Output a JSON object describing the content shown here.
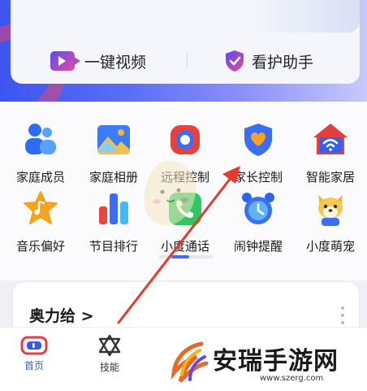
{
  "top_actions": [
    {
      "label": "一键视频",
      "icon": "video-call-icon"
    },
    {
      "label": "看护助手",
      "icon": "shield-icon"
    }
  ],
  "features": [
    {
      "label": "家庭成员",
      "icon": "family-members-icon"
    },
    {
      "label": "家庭相册",
      "icon": "photo-album-icon"
    },
    {
      "label": "远程控制",
      "icon": "remote-control-icon"
    },
    {
      "label": "家长控制",
      "icon": "parental-control-icon"
    },
    {
      "label": "智能家居",
      "icon": "smart-home-icon"
    },
    {
      "label": "音乐偏好",
      "icon": "music-star-icon"
    },
    {
      "label": "节目排行",
      "icon": "ranking-bars-icon"
    },
    {
      "label": "小度通话",
      "icon": "phone-call-icon"
    },
    {
      "label": "闹钟提醒",
      "icon": "alarm-clock-icon"
    },
    {
      "label": "小度萌宠",
      "icon": "pet-dog-icon"
    }
  ],
  "scroll_position": 0.33,
  "card": {
    "title": "奥力给 >"
  },
  "bottom_nav": [
    {
      "label": "首页",
      "icon": "home-icon",
      "active": true
    },
    {
      "label": "技能",
      "icon": "skills-icon",
      "active": false
    }
  ],
  "watermark": {
    "title": "安瑞手游网",
    "url": "www.szerg.com"
  },
  "colors": {
    "accent": "#4968f0",
    "annotation": "#e8392b",
    "active_nav": "#3a5bd9"
  }
}
